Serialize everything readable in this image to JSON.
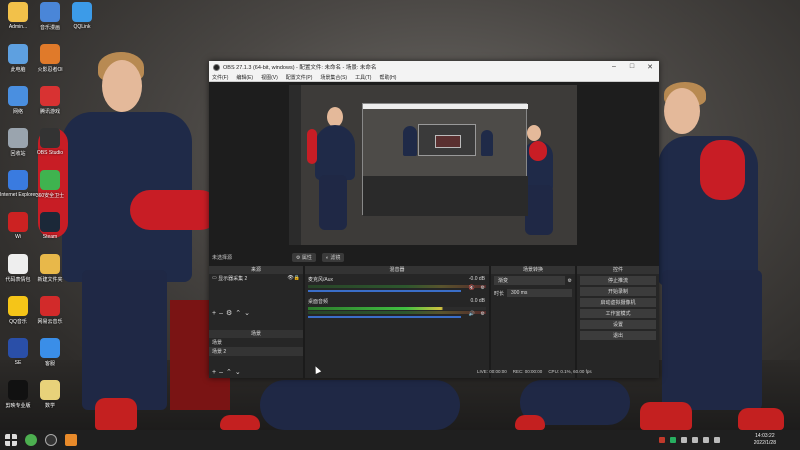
{
  "desktop_icons": [
    {
      "label": "Admin...",
      "color": "#f2c14a"
    },
    {
      "label": "音乐漫画",
      "color": "#4a86d8"
    },
    {
      "label": "QQLink",
      "color": "#3c9be8"
    },
    {
      "label": "此电脑",
      "color": "#5ea0e0"
    },
    {
      "label": "火影忍者Ol",
      "color": "#e07a2a"
    },
    {
      "label": "网络",
      "color": "#4a8fe0"
    },
    {
      "label": "腾讯游戏",
      "color": "#d83232"
    },
    {
      "label": "回收站",
      "color": "#9aa4ae"
    },
    {
      "label": "OBS Studio",
      "color": "#333333"
    },
    {
      "label": "Internet Explorer",
      "color": "#3a7be0"
    },
    {
      "label": "360安全卫士",
      "color": "#3fb34f"
    },
    {
      "label": "Wi",
      "color": "#cc2222"
    },
    {
      "label": "Steam",
      "color": "#1b2838"
    },
    {
      "label": "代码表情包",
      "color": "#eeeeee"
    },
    {
      "label": "新建文件夹",
      "color": "#e8b84a"
    },
    {
      "label": "QQ音乐",
      "color": "#f5c518"
    },
    {
      "label": "网易云音乐",
      "color": "#d22a2a"
    },
    {
      "label": "SE",
      "color": "#2a4fa8"
    },
    {
      "label": "客服",
      "color": "#3a8ee8"
    },
    {
      "label": "剪映专业版",
      "color": "#111111"
    },
    {
      "label": "数学",
      "color": "#e8d27a"
    }
  ],
  "window": {
    "title": "OBS 27.1.3 (64-bit, windows) - 配置文件: 未命名 - 场景: 未命名",
    "menu": [
      "文件(F)",
      "编辑(E)",
      "视图(V)",
      "配置文件(P)",
      "场景集合(S)",
      "工具(T)",
      "帮助(H)"
    ]
  },
  "source_toolbar": {
    "label": "未选择源",
    "properties": "属性",
    "filters": "滤镜"
  },
  "docks": {
    "sources": {
      "title": "来源",
      "items": [
        "显示器采集 2"
      ]
    },
    "scenes": {
      "title": "场景",
      "items": [
        "场景",
        "场景 2"
      ]
    },
    "mixer": {
      "title": "混音器",
      "channels": [
        {
          "name": "麦克风/Aux",
          "db": "-0.0 dB"
        },
        {
          "name": "桌面音频",
          "db": "0.0 dB"
        }
      ]
    },
    "transitions": {
      "title": "场景转换",
      "type": "渐变",
      "duration_label": "时长",
      "duration": "300 ms"
    },
    "controls": {
      "title": "控件",
      "buttons": [
        "停止推流",
        "开始录制",
        "启动虚拟摄像机",
        "工作室模式",
        "设置",
        "退出"
      ]
    }
  },
  "status": {
    "live": "LIVE: 00:00:00",
    "rec": "REC: 00:00:00",
    "cpu": "CPU: 0.1%, 60.00 fps"
  },
  "taskbar": {
    "time": "14:03:22",
    "date": "2022/1/28"
  }
}
